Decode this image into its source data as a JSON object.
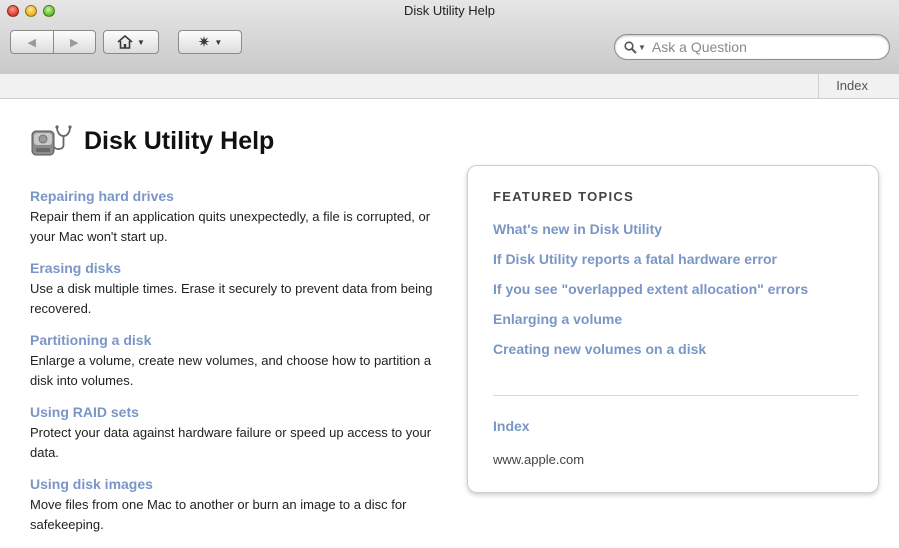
{
  "window": {
    "title": "Disk Utility Help"
  },
  "toolbar": {
    "back_icon": "back-arrow-icon",
    "forward_icon": "forward-arrow-icon",
    "home_icon": "home-icon",
    "gear_icon": "gear-icon",
    "search_placeholder": "Ask a Question"
  },
  "indexbar": {
    "link": "Index"
  },
  "page": {
    "title": "Disk Utility Help",
    "icon": "disk-utility-stethoscope-icon"
  },
  "topics": [
    {
      "title": "Repairing hard drives",
      "desc": "Repair them if an application quits unexpectedly, a file is corrupted, or your Mac won't start up."
    },
    {
      "title": "Erasing disks",
      "desc": "Use a disk multiple times. Erase it securely to prevent data from being recovered."
    },
    {
      "title": "Partitioning a disk",
      "desc": "Enlarge a volume, create new volumes, and choose how to partition a disk into volumes."
    },
    {
      "title": "Using RAID sets",
      "desc": "Protect your data against hardware failure or speed up access to your data."
    },
    {
      "title": "Using disk images",
      "desc": "Move files from one Mac to another or burn an image to a disc for safekeeping."
    }
  ],
  "featured": {
    "heading": "FEATURED TOPICS",
    "links": [
      "What's new in Disk Utility",
      "If Disk Utility reports a fatal hardware error",
      "If you see \"overlapped extent allocation\" errors",
      "Enlarging a volume",
      "Creating new volumes on a disk"
    ],
    "index_link": "Index",
    "site": "www.apple.com"
  },
  "colors": {
    "link": "#7a96c6",
    "text": "#222222"
  }
}
